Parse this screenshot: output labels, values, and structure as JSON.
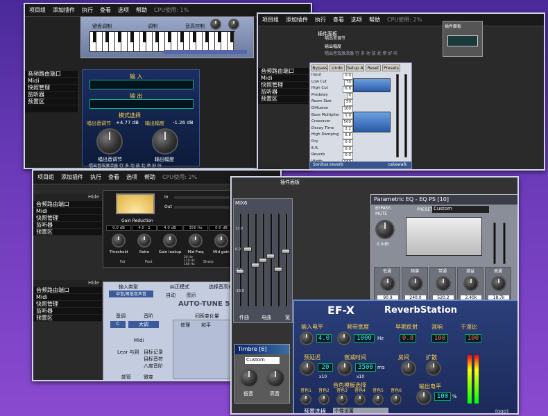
{
  "win1": {
    "menu": [
      "项目组",
      "添加插件",
      "执行",
      "查看",
      "选项",
      "帮助"
    ],
    "cpu": "CPU使用: 1%",
    "sidebar": {
      "hide": "Hide",
      "items": [
        "音频路由端口",
        "Midi",
        "快照管理",
        "监听器",
        "预置区"
      ]
    },
    "plugin_input": "输 入",
    "plugin_output": "输 出",
    "mode_label": "模式选择",
    "pitch_label": "唱出音调节",
    "pitch_value": "+4.77 dB",
    "output_amp_label": "输出幅度",
    "output_amp_value": "-1.26 dB",
    "knob1_label": "唱出音调节",
    "knob2_label": "输出幅度",
    "brand": "唱出音效激活器  行 多 功 放  北 帝 好 咔",
    "kbd_label1": "键盘调制",
    "kbd_label2": "调制",
    "kbd_label3": "音高控制"
  },
  "win2": {
    "menu": [
      "项目组",
      "添加插件",
      "执行",
      "查看",
      "选项",
      "帮助",
      "CPU使用: 2%"
    ],
    "plugin_title": "插件面板",
    "label1": "唱出音调节",
    "label2": "输出幅度",
    "brand": "唱出音效激活器  行 多 功 放  北 帝 好 咔",
    "sidebar": {
      "items": [
        "音频路由端口",
        "Midi",
        "快照管理",
        "监听器",
        "预置区"
      ]
    },
    "reverb": {
      "buttons": [
        "Bypass",
        "Undo",
        "Setup A",
        "Reset",
        "Presets"
      ],
      "params": [
        {
          "name": "Input",
          "value": "0.0"
        },
        {
          "name": "Low Cut",
          "value": "70"
        },
        {
          "name": "High Cut",
          "value": "6.8"
        },
        {
          "name": "Predelay",
          "value": "0"
        },
        {
          "name": "Room Size",
          "value": "50"
        },
        {
          "name": "Diffusion",
          "value": "100"
        },
        {
          "name": "Bass Multiplier",
          "value": "1.0"
        },
        {
          "name": "Crossover",
          "value": "500"
        },
        {
          "name": "Decay Time",
          "value": "2.2"
        },
        {
          "name": "High Damping",
          "value": "6.8"
        },
        {
          "name": "Dry",
          "value": "0.0"
        },
        {
          "name": "E.R.",
          "value": "0.0"
        },
        {
          "name": "Reverb",
          "value": "0.0"
        },
        {
          "name": "Width",
          "value": "100"
        }
      ],
      "footer_left": "Sonitus:reverb",
      "footer_right": "cakewalk"
    },
    "side_title": "插件面板"
  },
  "win3": {
    "menu": [
      "项目组",
      "添加插件",
      "执行",
      "查看",
      "选项",
      "帮助"
    ],
    "cpu": "CPU使用: 2%",
    "sidebar": {
      "hide": "Hide",
      "items": [
        "音频路由端口",
        "Midi",
        "快照管理",
        "监听器",
        "预置区"
      ]
    },
    "comp": {
      "title": "Gain Reduction",
      "in": "In",
      "out": "Out",
      "knobs": [
        {
          "label": "Threshold",
          "value": "0.0 dB"
        },
        {
          "label": "Ratio",
          "value": "4.0 : 1"
        },
        {
          "label": "Gain leakup",
          "value": "4.0 dB"
        },
        {
          "label": "Mid Freq",
          "value": "350 Hz"
        },
        {
          "label": "Mid gain",
          "value": "0.0 dB"
        }
      ],
      "freqs": [
        "20 Hz",
        "110 Hz",
        "160 Hz"
      ],
      "buttons": [
        "Fat",
        "Post",
        "Sharp"
      ]
    },
    "brand": "UR",
    "sidebar2": {
      "hide": "Hide",
      "items": [
        "音频路由端口",
        "Midi",
        "快照管理",
        "监听器",
        "预置区"
      ]
    },
    "autotune": {
      "title": "AUTO-TUNE 5",
      "input_type_label": "输入类型",
      "input_type_value": "中音/男低音声音",
      "correction_label": "纠正模式",
      "correction_value": "自动",
      "graph_label": "图示",
      "select_label": "选择音高修正参考",
      "key_label": "基调",
      "scale_label": "音阶",
      "key_value": "C",
      "scale_value": "大调",
      "midi_label": "Midi",
      "learn_label": "Lear  与到",
      "target_label": "目标记录",
      "target_note": "目标音符",
      "pitch_shift": "八度音阶",
      "cols": [
        "修理",
        "和平"
      ],
      "top_label": "间距变化量",
      "notes": [
        "C",
        "C#",
        "D",
        "D#",
        "E",
        "F",
        "F#",
        "G",
        "G#",
        "A",
        "A#",
        "B"
      ],
      "mod_wheel": "卸管",
      "degree": "微变"
    }
  },
  "win4": {
    "title": "插件面板",
    "mixer_title": "MIX6",
    "channel_labels": [
      "件曲",
      "电曲",
      "宽"
    ],
    "scale_labels": [
      "12.0",
      "0.0",
      "-6.0",
      "-18.0"
    ],
    "timbre_title": "Timbre [6]",
    "timbre_preset": "Custom",
    "timbre_knobs": [
      "低音",
      "高音"
    ],
    "eq": {
      "title": "Parametric EQ - EQ PS [10]",
      "bypass": "BYPASS",
      "mute": "MUTE",
      "preset_label": "PRESET",
      "preset_value": "Custom",
      "gain": "0.0dB",
      "freq_values": [
        "90.9",
        "240.0",
        "520.2",
        "2.40k",
        "18.7k"
      ],
      "band_labels": [
        "低通",
        "频谱",
        "带通",
        "增益",
        "高通"
      ]
    },
    "reverb": {
      "logo": "EF-X",
      "title": "ReverbStation",
      "input_label": "输入电平",
      "width_label": "频带宽度",
      "early_label": "早期反射",
      "mix_label": "混响",
      "dry_wet_label": "干湿比",
      "predelay_label": "预延迟",
      "decay_label": "衰减时间",
      "room_label": "房间",
      "spread_label": "扩散",
      "output_label": "输出电平",
      "algo_label": "音色模板选择",
      "tones": [
        "音色1",
        "音色2",
        "音色3",
        "音色4",
        "音色5",
        "音色6"
      ],
      "preset_label": "预置选择",
      "preset_value": "个性设置",
      "footer_value": "[000]",
      "input_value": "4.0",
      "width_value": "1000",
      "early_value": "0.8",
      "mix_value": "100",
      "dry_wet_value": "100",
      "predelay_value": "20",
      "decay_value": "3500",
      "output_value": "100",
      "hz": "Hz",
      "ms": "ms",
      "pct": "%",
      "x10": "x10"
    }
  }
}
